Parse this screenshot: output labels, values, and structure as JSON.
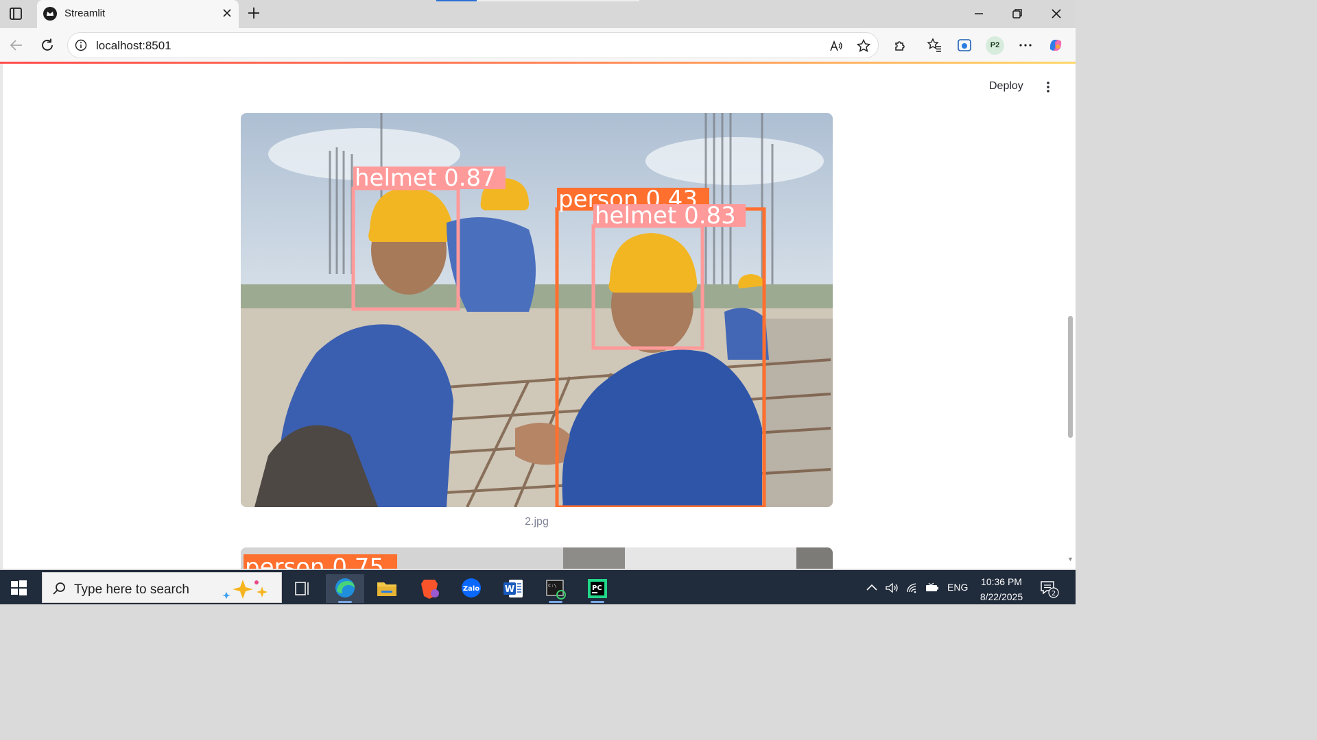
{
  "browser": {
    "tab_title": "Streamlit",
    "url": "localhost:8501",
    "profile_initials": "P2"
  },
  "app": {
    "deploy_label": "Deploy",
    "images": [
      {
        "caption": "2.jpg",
        "detections": [
          {
            "label": "helmet 0.87",
            "class": "helmet",
            "confidence": 0.87,
            "color": "#ff9a9a"
          },
          {
            "label": "person 0.43",
            "class": "person",
            "confidence": 0.43,
            "color": "#ff6f2e"
          },
          {
            "label": "helmet 0.83",
            "class": "helmet",
            "confidence": 0.83,
            "color": "#ff9a9a"
          }
        ]
      },
      {
        "caption": "",
        "detections": [
          {
            "label": "person 0.75",
            "class": "person",
            "confidence": 0.75,
            "color": "#ff6f2e"
          }
        ]
      }
    ]
  },
  "taskbar": {
    "search_placeholder": "Type here to search",
    "apps": [
      "edge",
      "file-explorer",
      "brave",
      "zalo",
      "word",
      "terminal",
      "pycharm"
    ],
    "language": "ENG",
    "time": "10:36 PM",
    "date": "8/22/2025",
    "notification_count": "2"
  }
}
